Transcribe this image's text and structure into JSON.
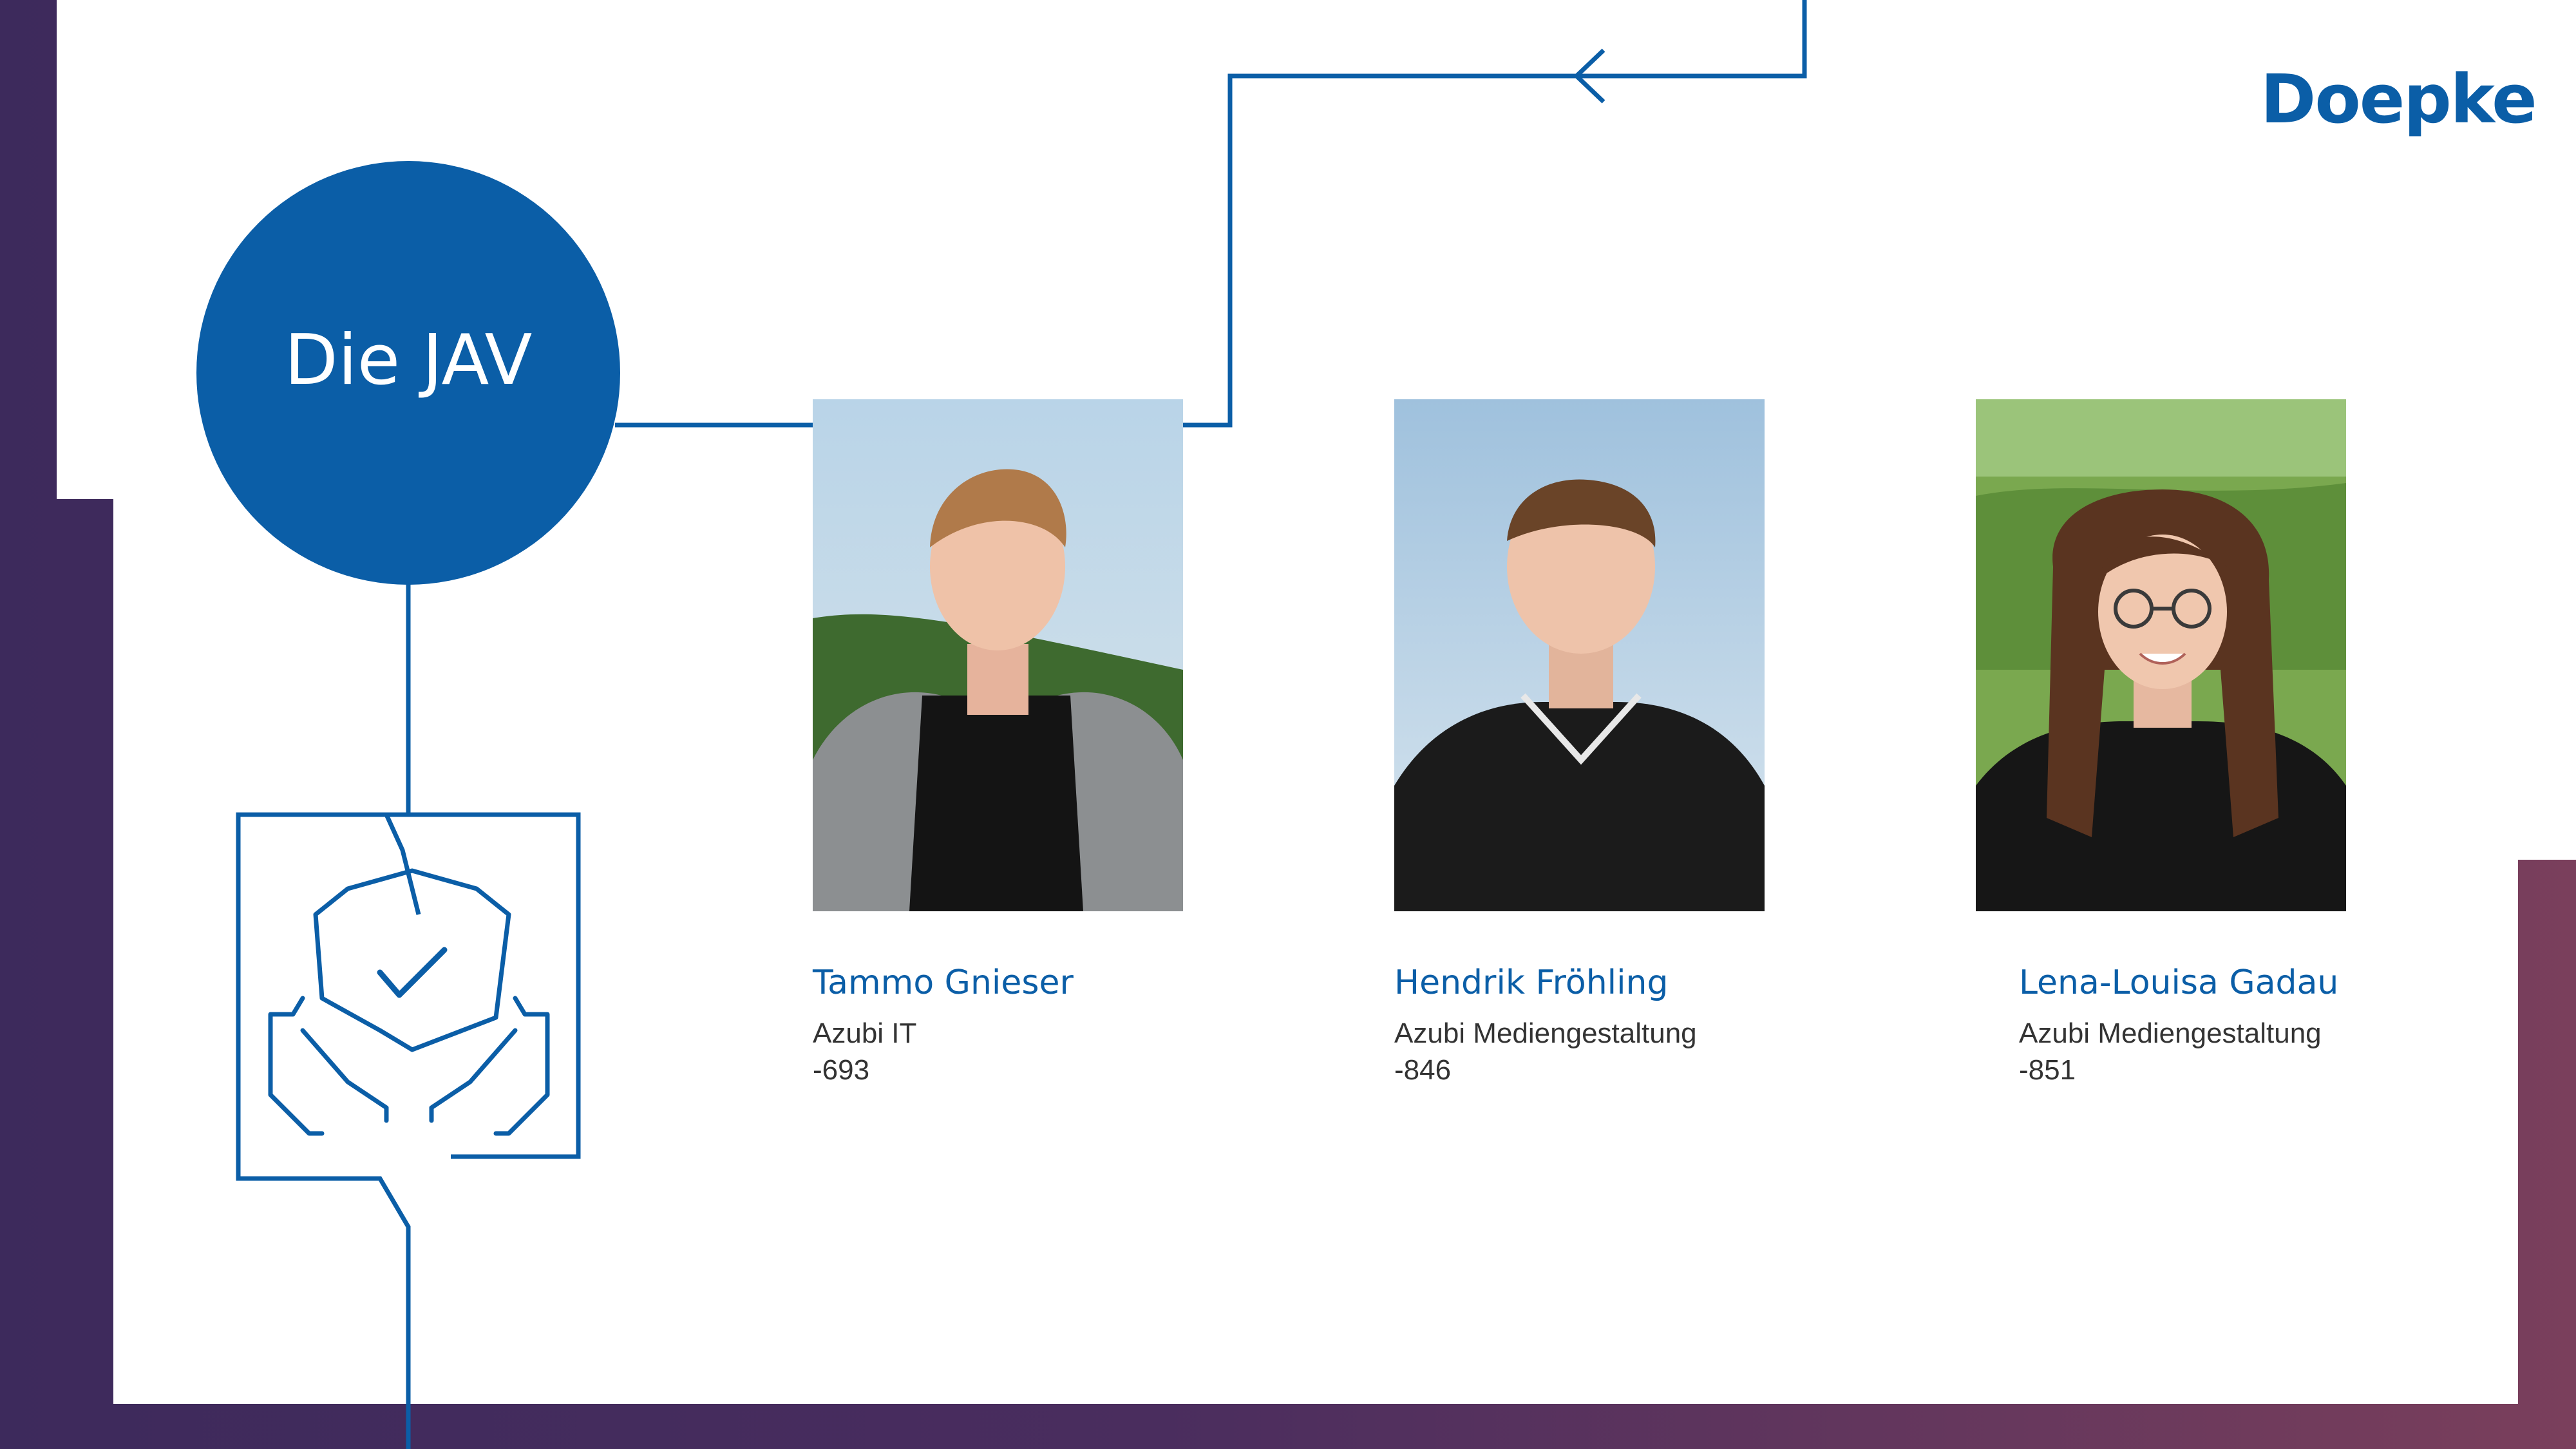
{
  "brand": {
    "logo": "Doepke",
    "color": "#0b5ea7"
  },
  "title": "Die JAV",
  "icon": "shield-check-hands-icon",
  "members": [
    {
      "name": "Tammo Gnieser",
      "role": "Azubi IT",
      "extension": "-693",
      "photo": "portrait-photo"
    },
    {
      "name": "Hendrik Fröhling",
      "role": "Azubi Mediengestaltung",
      "extension": "-846",
      "photo": "portrait-photo"
    },
    {
      "name": "Lena-Louisa Gadau",
      "role": "Azubi Mediengestaltung",
      "extension": "-851",
      "photo": "portrait-photo"
    }
  ]
}
